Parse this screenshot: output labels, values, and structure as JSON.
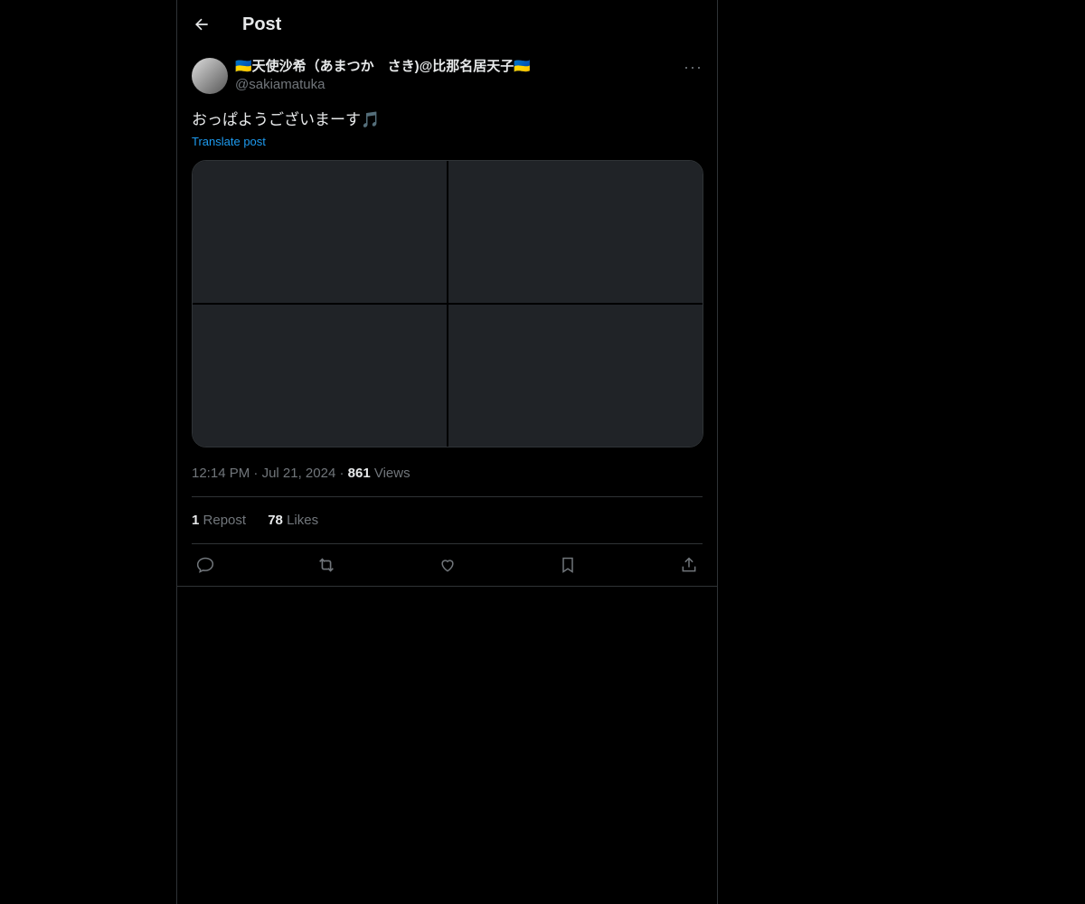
{
  "header": {
    "title": "Post",
    "back_icon": "arrow-left-icon"
  },
  "post": {
    "display_name": "🇺🇦天使沙希（あまつか　さき)@比那名居天子🇺🇦",
    "handle": "@sakiamatuka",
    "text": "おっぱようございまーす🎵",
    "translate_label": "Translate post",
    "media_count": 4,
    "time": "12:14 PM",
    "date": "Jul 21, 2024",
    "views_count": "861",
    "views_label": "Views",
    "repost_count": "1",
    "repost_label": "Repost",
    "likes_count": "78",
    "likes_label": "Likes"
  },
  "actions": [
    "reply-icon",
    "repost-icon",
    "like-icon",
    "bookmark-icon",
    "share-icon"
  ]
}
